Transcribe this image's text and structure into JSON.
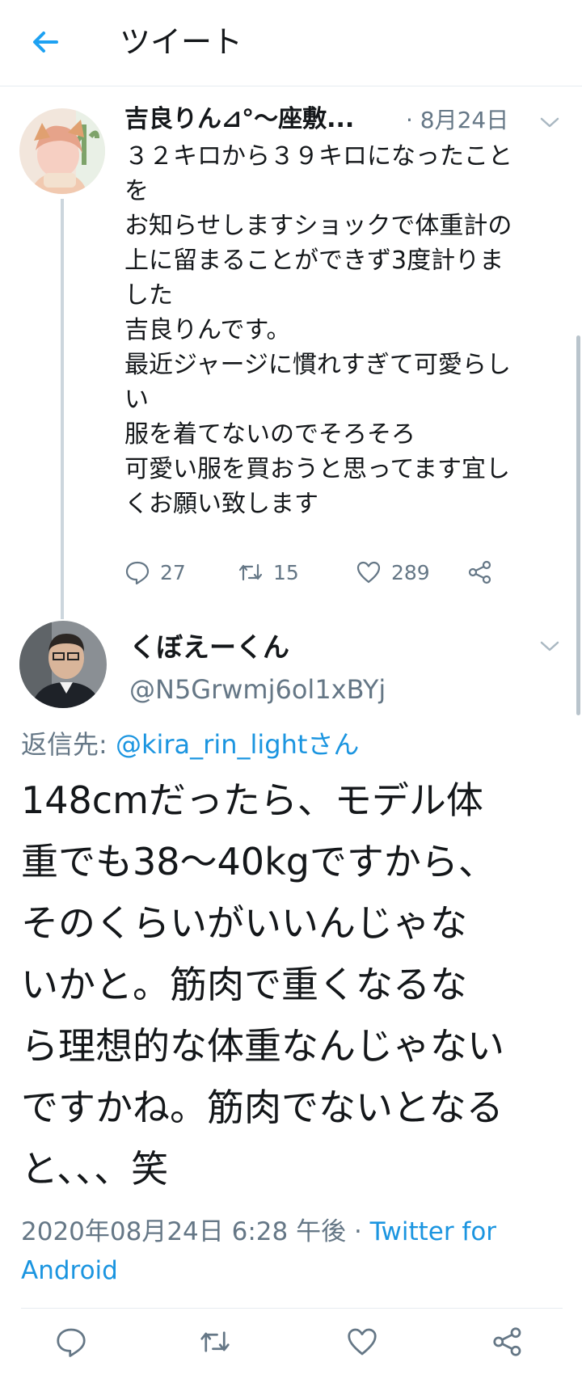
{
  "header": {
    "title": "ツイート",
    "back_icon": "arrow-left-icon"
  },
  "parent_tweet": {
    "display_name": "吉良りん⊿°〜座敷...",
    "date": "· 8月24日",
    "text": "３２キロから３９キロになったこと\nを\nお知らせしますショックで体重計の\n上に留まることができず3度計りま\nした\n吉良りんです。\n最近ジャージに慣れすぎて可愛らし\nい\n服を着てないのでそろそろ\n可愛い服を買おうと思ってます宜し\nくお願い致します",
    "replies": "27",
    "retweets": "15",
    "likes": "289"
  },
  "main_tweet": {
    "display_name": "くぼえーくん",
    "handle": "@N5Grwmj6ol1xBYj",
    "reply_prefix": "返信先: ",
    "reply_mention": "@kira_rin_lightさん",
    "text": "148cmだったら、モデル体\n重でも38〜40kgですから、\nそのくらいがいいんじゃな\nいかと。筋肉で重くなるな\nら理想的な体重なんじゃない\nですかね。筋肉でないとなる\nと、、、笑",
    "timestamp": "2020年08月24日 6:28 午後 · ",
    "source": "Twitter for Android"
  },
  "colors": {
    "accent": "#1da1f2",
    "link": "#1b95e0",
    "secondary": "#657786",
    "divider": "#e6ecf0"
  }
}
